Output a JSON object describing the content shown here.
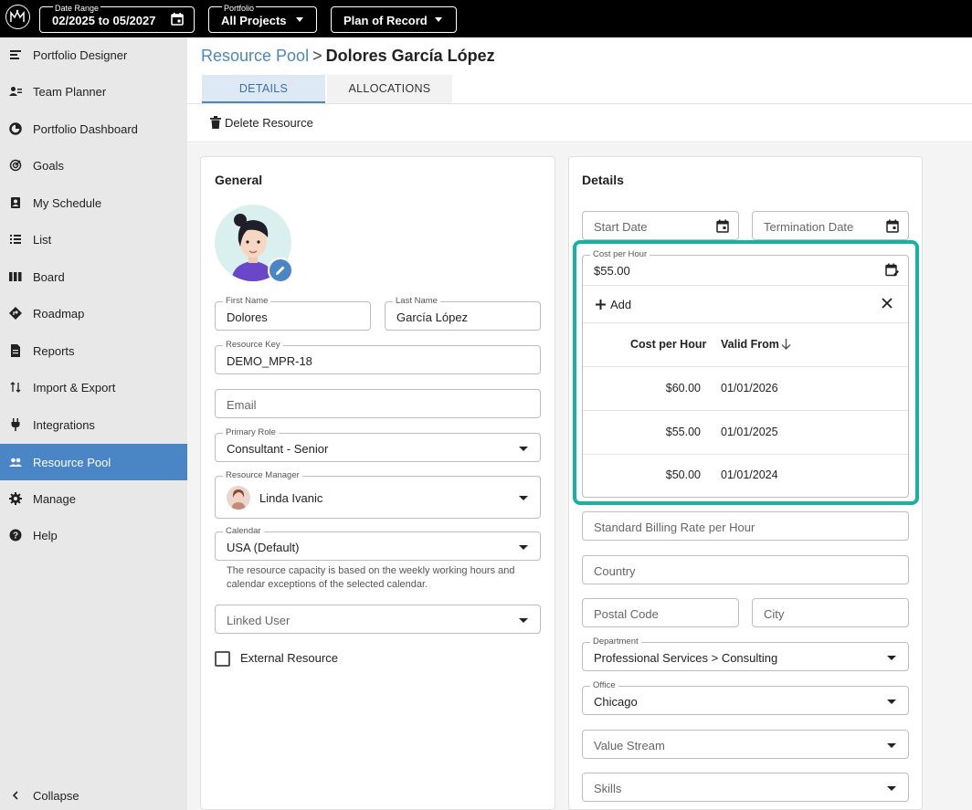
{
  "topbar": {
    "date_range": {
      "label": "Date Range",
      "value": "02/2025 to 05/2027"
    },
    "portfolio": {
      "label": "Portfolio",
      "value": "All Projects"
    },
    "plan": {
      "value": "Plan of Record"
    }
  },
  "sidebar": {
    "items": [
      {
        "label": "Portfolio Designer",
        "icon": "portfolio-designer-icon"
      },
      {
        "label": "Team Planner",
        "icon": "team-planner-icon"
      },
      {
        "label": "Portfolio Dashboard",
        "icon": "dashboard-icon"
      },
      {
        "label": "Goals",
        "icon": "goals-icon"
      },
      {
        "label": "My Schedule",
        "icon": "schedule-icon"
      },
      {
        "label": "List",
        "icon": "list-icon"
      },
      {
        "label": "Board",
        "icon": "board-icon"
      },
      {
        "label": "Roadmap",
        "icon": "roadmap-icon"
      },
      {
        "label": "Reports",
        "icon": "reports-icon"
      },
      {
        "label": "Import & Export",
        "icon": "import-export-icon"
      },
      {
        "label": "Integrations",
        "icon": "plug-icon"
      },
      {
        "label": "Resource Pool",
        "icon": "people-icon",
        "active": true
      },
      {
        "label": "Manage",
        "icon": "gear-icon"
      },
      {
        "label": "Help",
        "icon": "help-icon"
      }
    ],
    "collapse_label": "Collapse"
  },
  "header": {
    "breadcrumb_parent": "Resource Pool",
    "breadcrumb_separator": ">",
    "breadcrumb_current": "Dolores García López",
    "tabs": [
      {
        "label": "DETAILS",
        "active": true
      },
      {
        "label": "ALLOCATIONS",
        "active": false
      }
    ],
    "delete_label": "Delete Resource"
  },
  "general": {
    "title": "General",
    "first_name": {
      "label": "First Name",
      "value": "Dolores"
    },
    "last_name": {
      "label": "Last Name",
      "value": "García López"
    },
    "resource_key": {
      "label": "Resource Key",
      "value": "DEMO_MPR-18"
    },
    "email": {
      "placeholder": "Email"
    },
    "primary_role": {
      "label": "Primary Role",
      "value": "Consultant - Senior"
    },
    "resource_manager": {
      "label": "Resource Manager",
      "value": "Linda Ivanic"
    },
    "calendar": {
      "label": "Calendar",
      "value": "USA (Default)"
    },
    "calendar_help": "The resource capacity is based on the weekly working hours and calendar exceptions of the selected calendar.",
    "linked_user": {
      "placeholder": "Linked User"
    },
    "external_resource": {
      "label": "External Resource",
      "checked": false
    }
  },
  "details": {
    "title": "Details",
    "start_date": {
      "placeholder": "Start Date"
    },
    "termination_date": {
      "placeholder": "Termination Date"
    },
    "cost_per_hour": {
      "label": "Cost per Hour",
      "value": "$55.00",
      "add_label": "Add",
      "columns": [
        "Cost per Hour",
        "Valid From"
      ],
      "sort_indicator": "arrow-down-icon",
      "rows": [
        {
          "cost": "$60.00",
          "valid_from": "01/01/2026"
        },
        {
          "cost": "$55.00",
          "valid_from": "01/01/2025"
        },
        {
          "cost": "$50.00",
          "valid_from": "01/01/2024"
        }
      ]
    },
    "billing_rate": {
      "placeholder": "Standard Billing Rate per Hour"
    },
    "country": {
      "placeholder": "Country"
    },
    "postal_code": {
      "placeholder": "Postal Code"
    },
    "city": {
      "placeholder": "City"
    },
    "department": {
      "label": "Department",
      "value": "Professional Services > Consulting"
    },
    "office": {
      "label": "Office",
      "value": "Chicago"
    },
    "value_stream": {
      "placeholder": "Value Stream"
    },
    "skills": {
      "placeholder": "Skills"
    }
  },
  "colors": {
    "accent": "#4a86c5",
    "highlight": "#15b3a4",
    "topbar": "#000000",
    "sidebar": "#e8e8e8"
  }
}
